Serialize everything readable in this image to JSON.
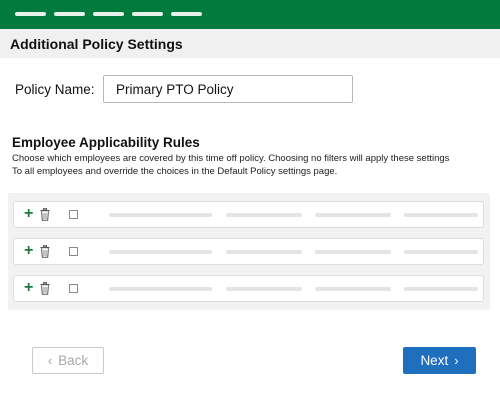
{
  "header": {
    "nav_placeholders": [
      "nav-item",
      "nav-item",
      "nav-item",
      "nav-item",
      "nav-item"
    ],
    "brand_color": "#007a3d"
  },
  "section": {
    "title": "Additional Policy Settings"
  },
  "policy": {
    "name_label": "Policy Name:",
    "name_value": "Primary PTO Policy"
  },
  "rules": {
    "title": "Employee Applicability Rules",
    "description_line1": "Choose which employees are covered by this time off policy. Choosing no filters will apply these settings",
    "description_line2": "To all employees and override the choices in the Default Policy settings page.",
    "rows": [
      {
        "add_icon": "plus-icon",
        "delete_icon": "trash-icon",
        "checked": false
      },
      {
        "add_icon": "plus-icon",
        "delete_icon": "trash-icon",
        "checked": false
      },
      {
        "add_icon": "plus-icon",
        "delete_icon": "trash-icon",
        "checked": false
      }
    ]
  },
  "footer": {
    "back_label": "Back",
    "next_label": "Next",
    "back_icon": "chevron-left-icon",
    "next_icon": "chevron-right-icon",
    "primary_color": "#1f6fbf"
  }
}
